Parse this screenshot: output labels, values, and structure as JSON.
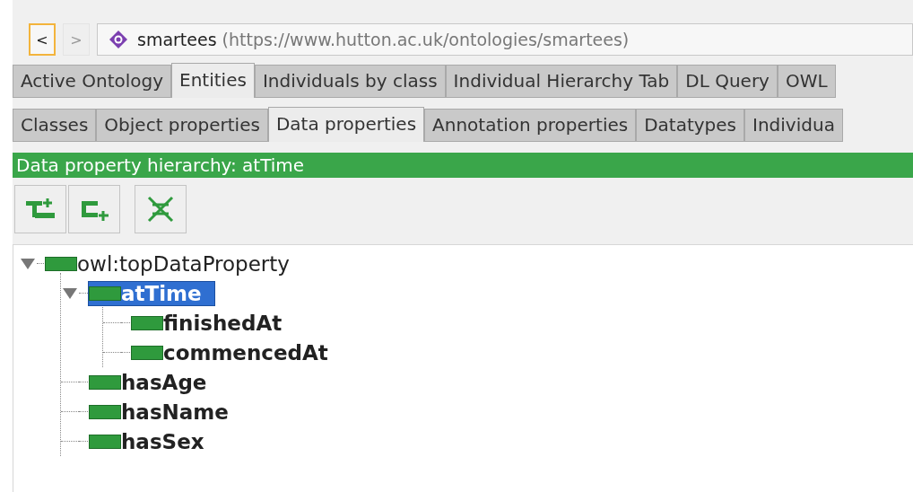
{
  "navigation": {
    "back": {
      "label": "<",
      "disabled": false
    },
    "forward": {
      "label": ">",
      "disabled": true
    }
  },
  "address": {
    "name": "smartees",
    "iri": "(https://www.hutton.ac.uk/ontologies/smartees)"
  },
  "main_tabs": [
    {
      "label": "Active Ontology",
      "selected": false
    },
    {
      "label": "Entities",
      "selected": true
    },
    {
      "label": "Individuals by class",
      "selected": false
    },
    {
      "label": "Individual Hierarchy Tab",
      "selected": false
    },
    {
      "label": "DL Query",
      "selected": false
    },
    {
      "label": "OWL",
      "selected": false
    }
  ],
  "entity_tabs": [
    {
      "label": "Classes",
      "selected": false
    },
    {
      "label": "Object properties",
      "selected": false
    },
    {
      "label": "Data properties",
      "selected": true
    },
    {
      "label": "Annotation properties",
      "selected": false
    },
    {
      "label": "Datatypes",
      "selected": false
    },
    {
      "label": "Individua",
      "selected": false
    }
  ],
  "view_header": "Data property hierarchy: atTime",
  "toolbar": [
    {
      "kind": "add-sub"
    },
    {
      "kind": "add-sibling"
    },
    {
      "kind": "delete"
    }
  ],
  "tree": [
    {
      "label": "owl:topDataProperty",
      "selected": false,
      "expanded": true,
      "bold": false,
      "children": [
        {
          "label": "atTime",
          "selected": true,
          "expanded": true,
          "bold": true,
          "children": [
            {
              "label": "finishedAt",
              "selected": false,
              "bold": true
            },
            {
              "label": "commencedAt",
              "selected": false,
              "bold": true
            }
          ]
        },
        {
          "label": "hasAge",
          "selected": false,
          "bold": true
        },
        {
          "label": "hasName",
          "selected": false,
          "bold": true
        },
        {
          "label": "hasSex",
          "selected": false,
          "bold": true
        }
      ]
    }
  ]
}
